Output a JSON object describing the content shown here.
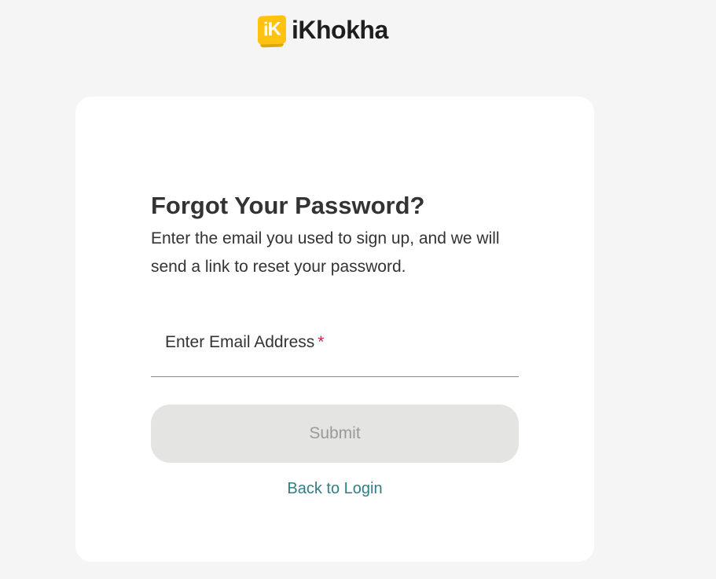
{
  "brand": {
    "badge_text": "iK",
    "name": "iKhokha",
    "badge_color": "#ffc20e"
  },
  "form": {
    "title": "Forgot Your Password?",
    "description": "Enter the email you used to sign up, and we will send a link to reset your password.",
    "email_label": "Enter Email Address",
    "required_marker": "*",
    "email_value": "",
    "submit_label": "Submit",
    "back_link_label": "Back to Login"
  },
  "colors": {
    "page_background": "#f5f5f5",
    "card_background": "#ffffff",
    "required_marker": "#c62845",
    "link": "#2f7e87",
    "disabled_button": "#e4e4e3"
  }
}
